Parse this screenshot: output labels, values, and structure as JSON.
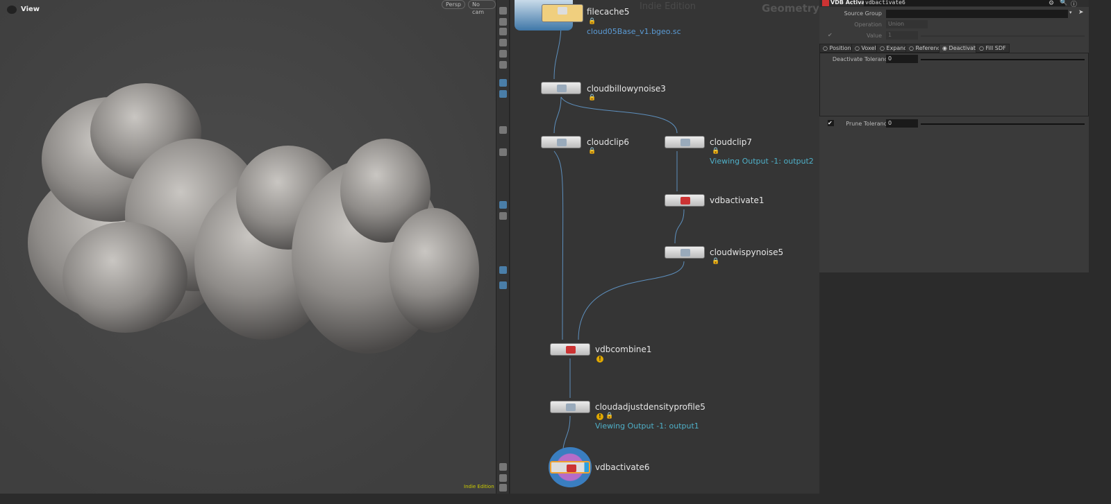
{
  "viewport": {
    "title": "View",
    "view_icon": "view-icon",
    "persp": "Persp",
    "cam": "No cam",
    "edition": "Indie Edition"
  },
  "network": {
    "watermark": "Indie Edition",
    "context": "Geometry",
    "nodes": [
      {
        "name": "filecache5",
        "sub": "cloud05Base_v1.bgeo.sc"
      },
      {
        "name": "cloudbillowynoise3"
      },
      {
        "name": "cloudclip6"
      },
      {
        "name": "cloudclip7",
        "sub": "Viewing Output -1: output2"
      },
      {
        "name": "vdbactivate1"
      },
      {
        "name": "cloudwispynoise5"
      },
      {
        "name": "vdbcombine1"
      },
      {
        "name": "cloudadjustdensityprofile5",
        "sub": "Viewing Output -1: output1"
      },
      {
        "name": "vdbactivate6"
      }
    ]
  },
  "params": {
    "node_type": "VDB Activate",
    "node_name": "vdbactivate6",
    "source_group_label": "Source Group",
    "source_group": "",
    "operation_label": "Operation",
    "operation": "Union",
    "value_label": "Value",
    "value": "1",
    "tabs": [
      "Position",
      "Voxel",
      "Expand",
      "Reference",
      "Deactivate",
      "Fill SDF"
    ],
    "active_tab": "Deactivate",
    "deactivate_tolerance_label": "Deactivate Tolerance",
    "deactivate_tolerance": "0",
    "prune_tolerance_label": "Prune Tolerance",
    "prune_tolerance": "0",
    "prune_enabled": true
  },
  "colors": {
    "accent": "#4fb0c8",
    "warning": "#e0a800",
    "filecache": "#f0cf7e",
    "display_flag": "#3a7ec0"
  }
}
